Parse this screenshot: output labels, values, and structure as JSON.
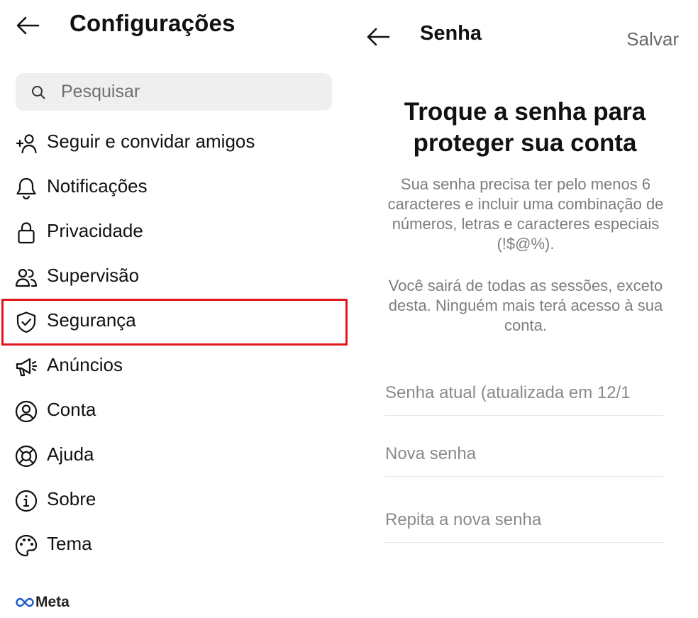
{
  "left": {
    "title": "Configurações",
    "search_placeholder": "Pesquisar",
    "items": [
      {
        "label": "Seguir e convidar amigos",
        "icon": "add-person-icon"
      },
      {
        "label": "Notificações",
        "icon": "bell-icon"
      },
      {
        "label": "Privacidade",
        "icon": "lock-icon"
      },
      {
        "label": "Supervisão",
        "icon": "people-icon"
      },
      {
        "label": "Segurança",
        "icon": "shield-check-icon"
      },
      {
        "label": "Anúncios",
        "icon": "megaphone-icon"
      },
      {
        "label": "Conta",
        "icon": "account-circle-icon"
      },
      {
        "label": "Ajuda",
        "icon": "lifebuoy-icon"
      },
      {
        "label": "Sobre",
        "icon": "info-icon"
      },
      {
        "label": "Tema",
        "icon": "palette-icon"
      }
    ],
    "highlighted_item": "Segurança",
    "highlight_color": "#e0161d",
    "footer": "Meta"
  },
  "right": {
    "title": "Senha",
    "save_label": "Salvar",
    "headline": "Troque a senha para proteger sua conta",
    "description_1": "Sua senha precisa ter pelo menos 6 caracteres e incluir uma combinação de números, letras e caracteres especiais (!$@%).",
    "description_2": "Você sairá de todas as sessões, exceto desta. Ninguém mais terá acesso à sua conta.",
    "fields": [
      {
        "placeholder": "Senha atual (atualizada em 12/1"
      },
      {
        "placeholder": "Nova senha"
      },
      {
        "placeholder": "Repita a nova senha"
      }
    ]
  }
}
